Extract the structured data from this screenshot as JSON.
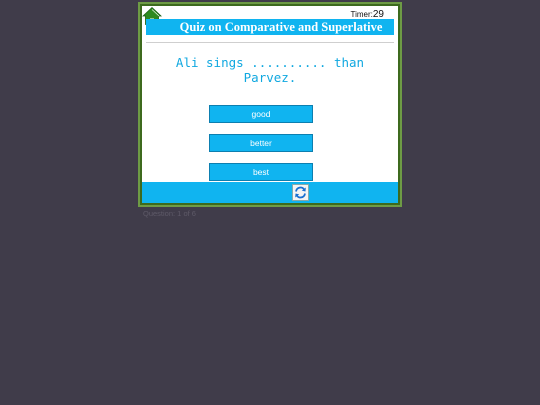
{
  "quiz": {
    "title": "Quiz on Comparative and Superlative",
    "timer_label": "Timer:",
    "timer_value": "29",
    "question": "Ali sings .......... than Parvez.",
    "options": [
      {
        "label": "good"
      },
      {
        "label": "better"
      },
      {
        "label": "best"
      }
    ],
    "counter": "Question: 1 of 6"
  },
  "icons": {
    "home": "home-icon",
    "refresh": "refresh-icon"
  },
  "colors": {
    "accent": "#10b4f0",
    "frame": "#3d6a1e",
    "home_icon": "#2f8a1e",
    "background": "#403c4a"
  }
}
